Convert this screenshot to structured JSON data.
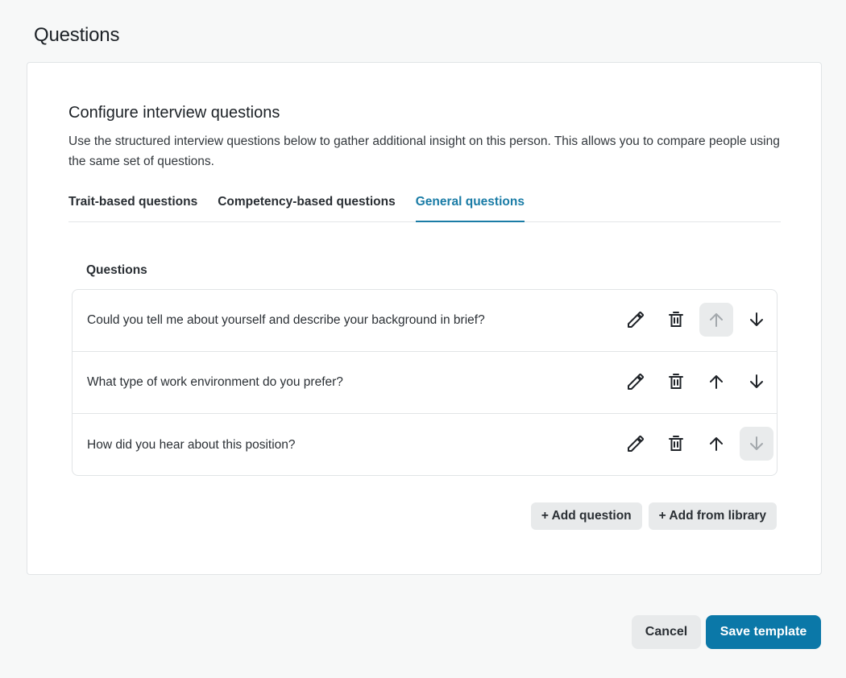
{
  "page": {
    "title": "Questions"
  },
  "section": {
    "title": "Configure interview questions",
    "description": "Use the structured interview questions below to gather additional insight on this person. This allows you to compare people using the same set of questions."
  },
  "tabs": [
    {
      "label": "Trait-based questions",
      "active": false
    },
    {
      "label": "Competency-based questions",
      "active": false
    },
    {
      "label": "General questions",
      "active": true
    }
  ],
  "questions_header": "Questions",
  "questions": [
    {
      "text": "Could you tell me about yourself and describe your background in brief?",
      "up_disabled": true,
      "down_disabled": false
    },
    {
      "text": "What type of work environment do you prefer?",
      "up_disabled": false,
      "down_disabled": false
    },
    {
      "text": "How did you hear about this position?",
      "up_disabled": false,
      "down_disabled": true
    }
  ],
  "icons": {
    "edit": "pencil-icon",
    "delete": "trash-icon",
    "up": "arrow-up-icon",
    "down": "arrow-down-icon"
  },
  "actions": {
    "add_question": "+ Add question",
    "add_from_library": "+ Add from library"
  },
  "footer": {
    "cancel": "Cancel",
    "save": "Save template"
  },
  "colors": {
    "accent": "#1a7ca6",
    "primary_button": "#0b78a8",
    "disabled_bg": "#e9ebec",
    "disabled_icon": "#a3a8ac",
    "icon": "#1f2328"
  }
}
